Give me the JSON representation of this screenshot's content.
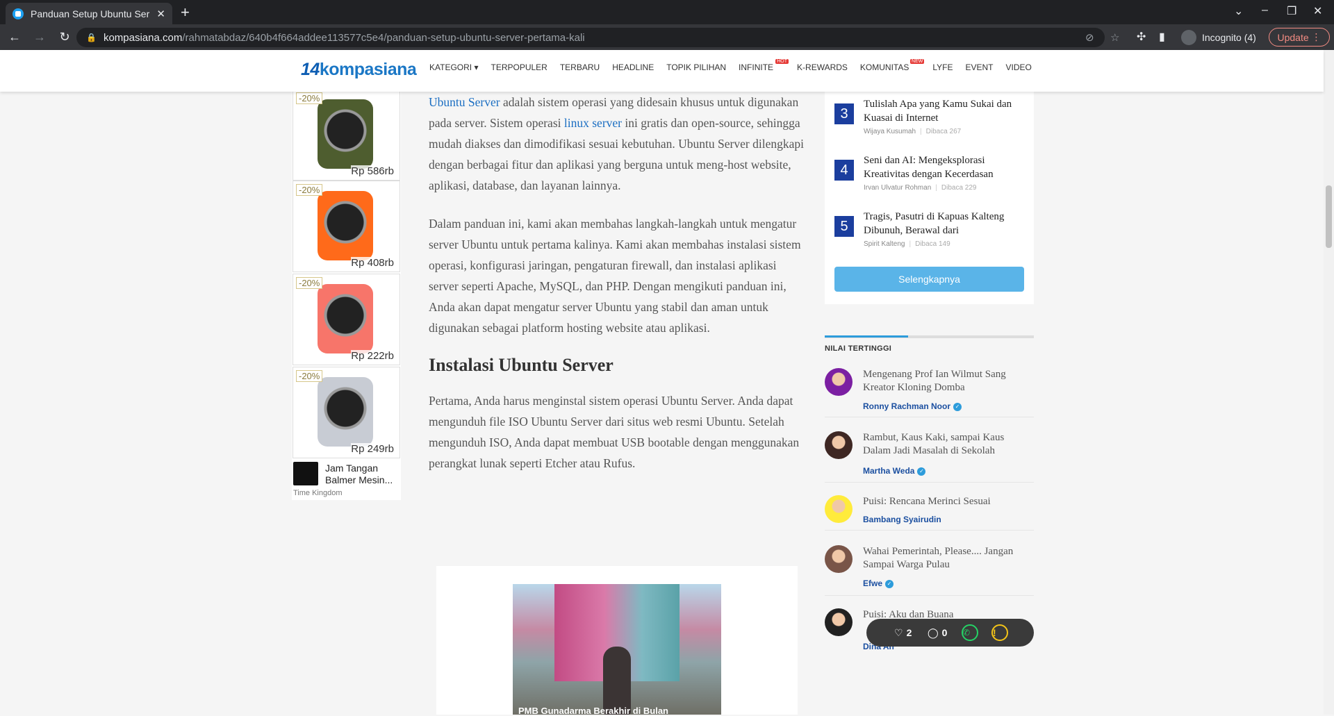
{
  "browser": {
    "tab_title": "Panduan Setup Ubuntu Ser",
    "url_domain": "kompasiana.com",
    "url_path": "/rahmatabdaz/640b4f664addee113577c5e4/panduan-setup-ubuntu-server-pertama-kali",
    "incognito_label": "Incognito (4)",
    "update_label": "Update"
  },
  "site": {
    "logo_mark": "14",
    "logo_text": "kompasiana",
    "nav": [
      {
        "label": "KATEGORI ▾",
        "badge": ""
      },
      {
        "label": "TERPOPULER",
        "badge": ""
      },
      {
        "label": "TERBARU",
        "badge": ""
      },
      {
        "label": "HEADLINE",
        "badge": ""
      },
      {
        "label": "TOPIK PILIHAN",
        "badge": ""
      },
      {
        "label": "INFINITE",
        "badge": "HOT"
      },
      {
        "label": "K-REWARDS",
        "badge": ""
      },
      {
        "label": "KOMUNITAS",
        "badge": "NEW"
      },
      {
        "label": "LYFE",
        "badge": ""
      },
      {
        "label": "EVENT",
        "badge": ""
      },
      {
        "label": "VIDEO",
        "badge": ""
      }
    ]
  },
  "ads": {
    "items": [
      {
        "discount": "-20%",
        "price": "Rp 586rb",
        "color": "#4e5d2f"
      },
      {
        "discount": "-20%",
        "price": "Rp 408rb",
        "color": "#ff6a1a"
      },
      {
        "discount": "-20%",
        "price": "Rp 222rb",
        "color": "#f7756a"
      },
      {
        "discount": "-20%",
        "price": "Rp 249rb",
        "color": "#c8ccd4"
      }
    ],
    "product_name": "Jam Tangan Balmer Mesin...",
    "source": "Time Kingdom"
  },
  "article": {
    "p1_link1": "Ubuntu Server",
    "p1_text1": " adalah sistem operasi yang didesain khusus untuk digunakan pada server. Sistem operasi ",
    "p1_link2": "linux server",
    "p1_text2": " ini gratis dan open-source, sehingga mudah diakses dan dimodifikasi sesuai kebutuhan. Ubuntu Server dilengkapi dengan berbagai fitur dan aplikasi yang berguna untuk meng-host website, aplikasi, database, dan layanan lainnya.",
    "p2": "Dalam panduan ini, kami akan membahas langkah-langkah untuk mengatur server Ubuntu untuk pertama kalinya. Kami akan membahas instalasi sistem operasi, konfigurasi jaringan, pengaturan firewall, dan instalasi aplikasi server seperti Apache, MySQL, dan PHP. Dengan mengikuti panduan ini, Anda akan dapat mengatur server Ubuntu yang stabil dan aman untuk digunakan sebagai platform hosting website atau aplikasi.",
    "h2": "Instalasi Ubuntu Server",
    "p3": "Pertama, Anda harus menginstal sistem operasi Ubuntu Server. Anda dapat mengunduh file ISO Ubuntu Server dari situs web resmi Ubuntu. Setelah mengunduh ISO, Anda dapat membuat USB bootable dengan menggunakan perangkat lunak seperti Etcher atau Rufus.",
    "image_caption": "PMB Gunadarma Berakhir di Bulan"
  },
  "sidebar": {
    "ranked": [
      {
        "num": "3",
        "title": "Tulislah Apa yang Kamu Sukai dan Kuasai di Internet",
        "author": "Wijaya Kusumah",
        "reads": "Dibaca 267"
      },
      {
        "num": "4",
        "title": "Seni dan AI: Mengeksplorasi Kreativitas dengan Kecerdasan",
        "author": "Irvan Ulvatur Rohman",
        "reads": "Dibaca 229"
      },
      {
        "num": "5",
        "title": "Tragis, Pasutri di Kapuas Kalteng Dibunuh, Berawal dari",
        "author": "Spirit Kalteng",
        "reads": "Dibaca 149"
      }
    ],
    "more_label": "Selengkapnya",
    "nilai_title": "NILAI TERTINGGI",
    "nilai": [
      {
        "title": "Mengenang Prof Ian Wilmut Sang Kreator Kloning Domba",
        "author": "Ronny Rachman Noor",
        "verified": "✓"
      },
      {
        "title": "Rambut, Kaus Kaki, sampai Kaus Dalam Jadi Masalah di Sekolah",
        "author": "Martha Weda",
        "verified": "✓"
      },
      {
        "title": "Puisi: Rencana Merinci Sesuai",
        "author": "Bambang Syairudin",
        "verified": ""
      },
      {
        "title": "Wahai Pemerintah, Please.... Jangan Sampai Warga Pulau",
        "author": "Efwe",
        "verified": "✓"
      },
      {
        "title": "Puisi: Aku dan Buana",
        "author": "Dina An",
        "verified": ""
      }
    ]
  },
  "reactions": {
    "likes": "2",
    "comments": "0"
  }
}
